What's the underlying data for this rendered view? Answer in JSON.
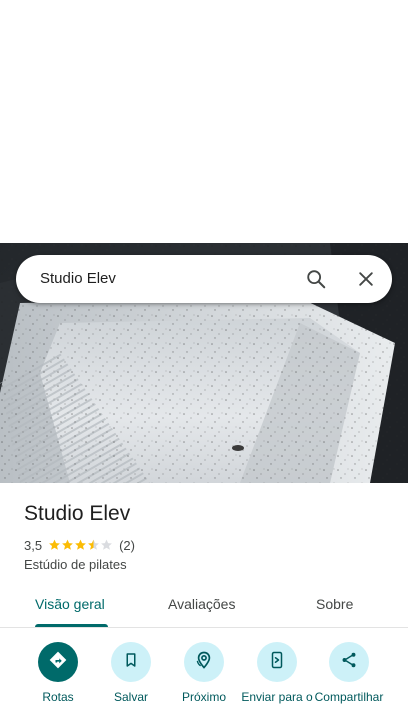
{
  "search": {
    "query": "Studio Elev"
  },
  "place": {
    "name": "Studio Elev",
    "rating": "3,5",
    "stars_value": 3.5,
    "review_count": "(2)",
    "category": "Estúdio de pilates"
  },
  "tabs": [
    {
      "label": "Visão geral",
      "active": true
    },
    {
      "label": "Avaliações",
      "active": false
    },
    {
      "label": "Sobre",
      "active": false
    }
  ],
  "actions": [
    {
      "label": "Rotas",
      "icon": "directions-icon"
    },
    {
      "label": "Salvar",
      "icon": "bookmark-icon"
    },
    {
      "label": "Próximo",
      "icon": "nearby-icon"
    },
    {
      "label": "Enviar para o",
      "icon": "send-to-phone-icon"
    },
    {
      "label": "Compartilhar",
      "icon": "share-icon"
    }
  ],
  "colors": {
    "accent": "#006a6a",
    "action_bg": "#cdf1f8",
    "star": "#fbbc04"
  }
}
